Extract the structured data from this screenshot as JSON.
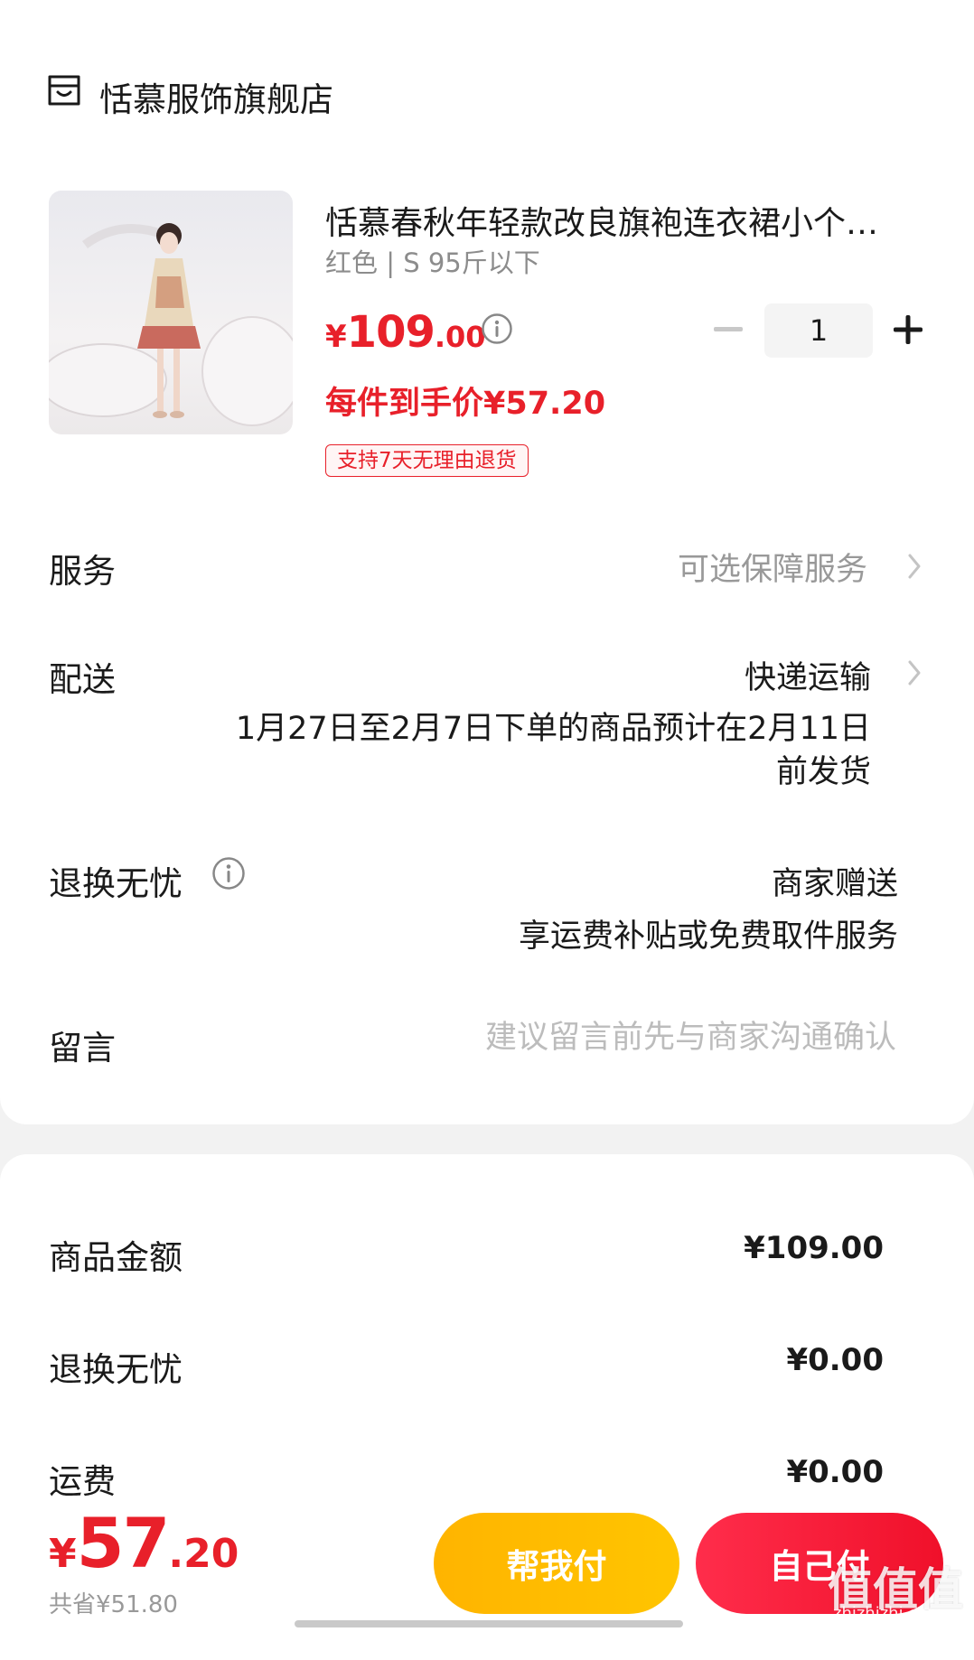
{
  "colors": {
    "accent_red": "#e8202a",
    "help_pay_yellow": "#ffb400",
    "muted_gray": "#999999"
  },
  "store": {
    "icon": "store-icon",
    "name": "恬慕服饰旗舰店"
  },
  "product": {
    "image_icon": "product-photo",
    "title": "恬慕春秋年轻款改良旗袍连衣裙小个…",
    "spec": "红色 | S 95斤以下",
    "price_yuan": "¥",
    "price_int": "109",
    "price_dec": ".00",
    "quantity": "1",
    "unit_price_text": "每件到手价¥57.20",
    "return_badge": "支持7天无理由退货"
  },
  "service": {
    "label": "服务",
    "value": "可选保障服务"
  },
  "delivery": {
    "label": "配送",
    "method": "快递运输",
    "note_line1": "1月27日至2月7日下单的商品预计在2月11日",
    "note_line2": "前发货"
  },
  "worry_free": {
    "label": "退换无忧",
    "value": "商家赠送",
    "sub": "享运费补贴或免费取件服务"
  },
  "message": {
    "label": "留言",
    "placeholder": "建议留言前先与商家沟通确认"
  },
  "summary": {
    "rows": [
      {
        "label": "商品金额",
        "value": "¥109.00"
      },
      {
        "label": "退换无忧",
        "value": "¥0.00"
      },
      {
        "label": "运费",
        "value": "¥0.00"
      }
    ]
  },
  "bottom": {
    "total_yuan": "¥",
    "total_int": "57",
    "total_dec": ".20",
    "savings": "共省¥51.80",
    "help_pay_label": "帮我付",
    "self_pay_label": "自己付"
  },
  "watermark": {
    "text": "值值值",
    "url": "zhizhizhi.com"
  }
}
